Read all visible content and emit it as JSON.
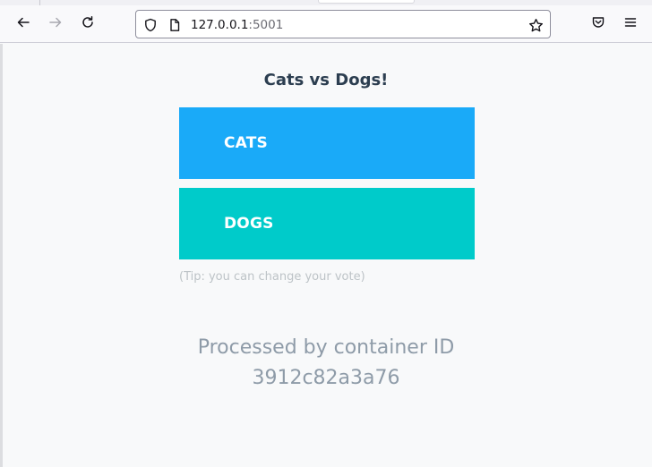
{
  "browser": {
    "url_host": "127.0.0.1",
    "url_port": ":5001",
    "icons": [
      "back-arrow-icon",
      "forward-arrow-icon",
      "reload-icon",
      "shield-icon",
      "page-icon",
      "star-icon",
      "pocket-icon",
      "hamburger-menu-icon"
    ]
  },
  "page": {
    "title": "Cats vs Dogs!",
    "option_a": "CATS",
    "option_b": "DOGS",
    "tip": "(Tip: you can change your vote)",
    "processed_line1": "Processed by container ID",
    "container_id": "3912c82a3a76"
  },
  "colors": {
    "cats": "#1aaaf8",
    "dogs": "#00cbca",
    "title": "#2c3e50",
    "tip": "#bdc3c7",
    "processed": "#8e9ba8"
  }
}
